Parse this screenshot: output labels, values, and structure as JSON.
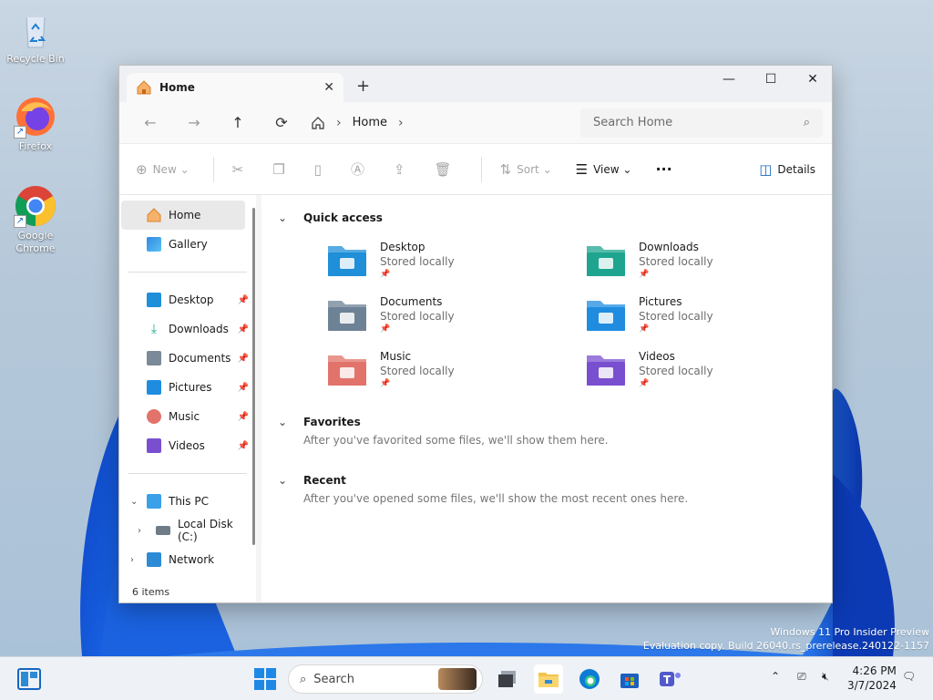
{
  "desktop": {
    "icons": [
      {
        "label": "Recycle Bin"
      },
      {
        "label": "Firefox"
      },
      {
        "label": "Google Chrome"
      }
    ],
    "watermark": {
      "line1": "Windows 11 Pro Insider Preview",
      "line2": "Evaluation copy. Build 26040.rs_prerelease.240122-1157"
    }
  },
  "window": {
    "tab_title": "Home",
    "new_tab": "+",
    "nav": {
      "breadcrumb": "Home",
      "search_placeholder": "Search Home"
    },
    "toolbar": {
      "new_label": "New",
      "sort_label": "Sort",
      "view_label": "View",
      "more_label": "···",
      "details_label": "Details"
    },
    "sidebar": {
      "top": [
        {
          "label": "Home"
        },
        {
          "label": "Gallery"
        }
      ],
      "pinned": [
        {
          "label": "Desktop"
        },
        {
          "label": "Downloads"
        },
        {
          "label": "Documents"
        },
        {
          "label": "Pictures"
        },
        {
          "label": "Music"
        },
        {
          "label": "Videos"
        }
      ],
      "tree": [
        {
          "label": "This PC"
        },
        {
          "label": "Local Disk (C:)"
        },
        {
          "label": "Network"
        }
      ]
    },
    "content": {
      "quick_access": {
        "title": "Quick access",
        "items": [
          {
            "name": "Desktop",
            "sub": "Stored locally",
            "color": "#1e8fd8"
          },
          {
            "name": "Downloads",
            "sub": "Stored locally",
            "color": "#1fa58f"
          },
          {
            "name": "Documents",
            "sub": "Stored locally",
            "color": "#6e8296"
          },
          {
            "name": "Pictures",
            "sub": "Stored locally",
            "color": "#1f8ce0"
          },
          {
            "name": "Music",
            "sub": "Stored locally",
            "color": "#e2736a"
          },
          {
            "name": "Videos",
            "sub": "Stored locally",
            "color": "#7a4fcf"
          }
        ]
      },
      "favorites": {
        "title": "Favorites",
        "message": "After you've favorited some files, we'll show them here."
      },
      "recent": {
        "title": "Recent",
        "message": "After you've opened some files, we'll show the most recent ones here."
      }
    },
    "status": "6 items"
  },
  "taskbar": {
    "search_label": "Search",
    "time": "4:26 PM",
    "date": "3/7/2024"
  }
}
